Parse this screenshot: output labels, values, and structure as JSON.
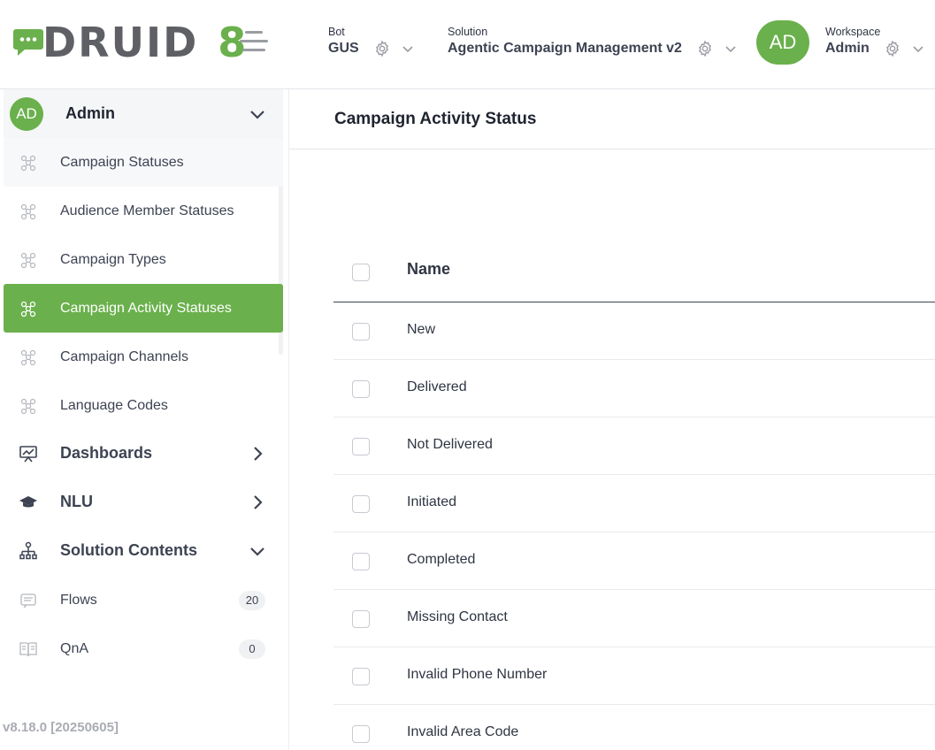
{
  "brand": {
    "name": "DRUID",
    "version": "8",
    "accent": "#6ab04c"
  },
  "header": {
    "bot": {
      "label": "Bot",
      "value": "GUS"
    },
    "solution": {
      "label": "Solution",
      "value": "Agentic Campaign Management v2"
    },
    "user_initials": "AD",
    "workspace": {
      "label": "Workspace",
      "value": "Admin"
    }
  },
  "sidebar": {
    "group": {
      "initials": "AD",
      "label": "Admin"
    },
    "items": [
      {
        "label": "Campaign Statuses",
        "icon": "entity-icon"
      },
      {
        "label": "Audience Member Statuses",
        "icon": "entity-icon"
      },
      {
        "label": "Campaign Types",
        "icon": "entity-icon"
      },
      {
        "label": "Campaign Activity Statuses",
        "icon": "entity-icon"
      },
      {
        "label": "Campaign Channels",
        "icon": "entity-icon"
      },
      {
        "label": "Language Codes",
        "icon": "entity-icon"
      },
      {
        "label": "Dashboards",
        "icon": "dashboard-icon"
      },
      {
        "label": "NLU",
        "icon": "graduation-cap-icon"
      },
      {
        "label": "Solution Contents",
        "icon": "hierarchy-icon"
      },
      {
        "label": "Flows",
        "icon": "flows-icon",
        "count": "20"
      },
      {
        "label": "QnA",
        "icon": "book-icon",
        "count": "0"
      }
    ],
    "version": "v8.18.0 [20250605]"
  },
  "main": {
    "title": "Campaign Activity Status",
    "columns": [
      "Name"
    ],
    "rows": [
      "New",
      "Delivered",
      "Not Delivered",
      "Initiated",
      "Completed",
      "Missing Contact",
      "Invalid Phone Number",
      "Invalid Area Code"
    ]
  }
}
